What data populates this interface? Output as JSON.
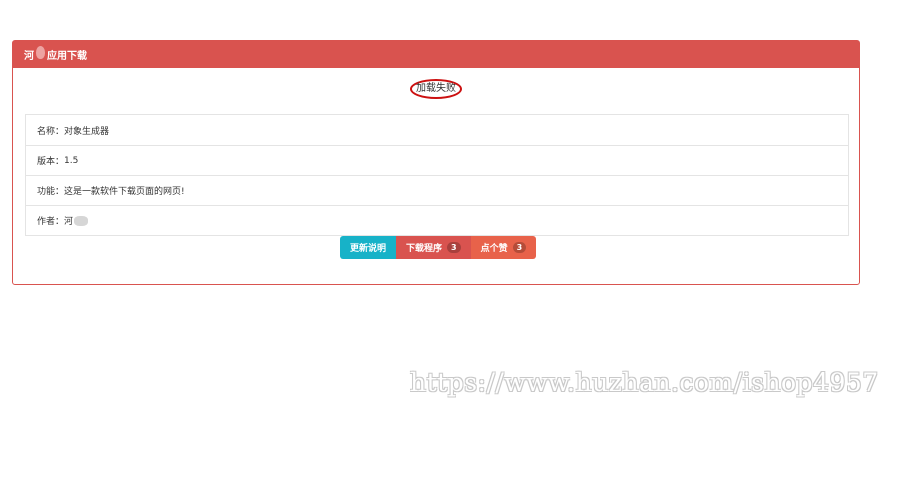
{
  "panel": {
    "title_prefix": "河",
    "title_suffix": "应用下载",
    "image_alt": "加载失败"
  },
  "info": {
    "rows": [
      {
        "label": "名称：",
        "value": "对象生成器"
      },
      {
        "label": "版本：",
        "value": "1.5"
      },
      {
        "label": "功能：",
        "value": "这是一款软件下载页面的网页!"
      },
      {
        "label": "作者：",
        "value": "河"
      }
    ]
  },
  "buttons": {
    "update_label": "更新说明",
    "download_label": "下载程序",
    "download_count": "3",
    "like_label": "点个赞",
    "like_count": "3"
  },
  "watermark": "https://www.huzhan.com/ishop4957",
  "colors": {
    "danger": "#d9534f",
    "info": "#17b2c8",
    "orange": "#e8624a"
  }
}
